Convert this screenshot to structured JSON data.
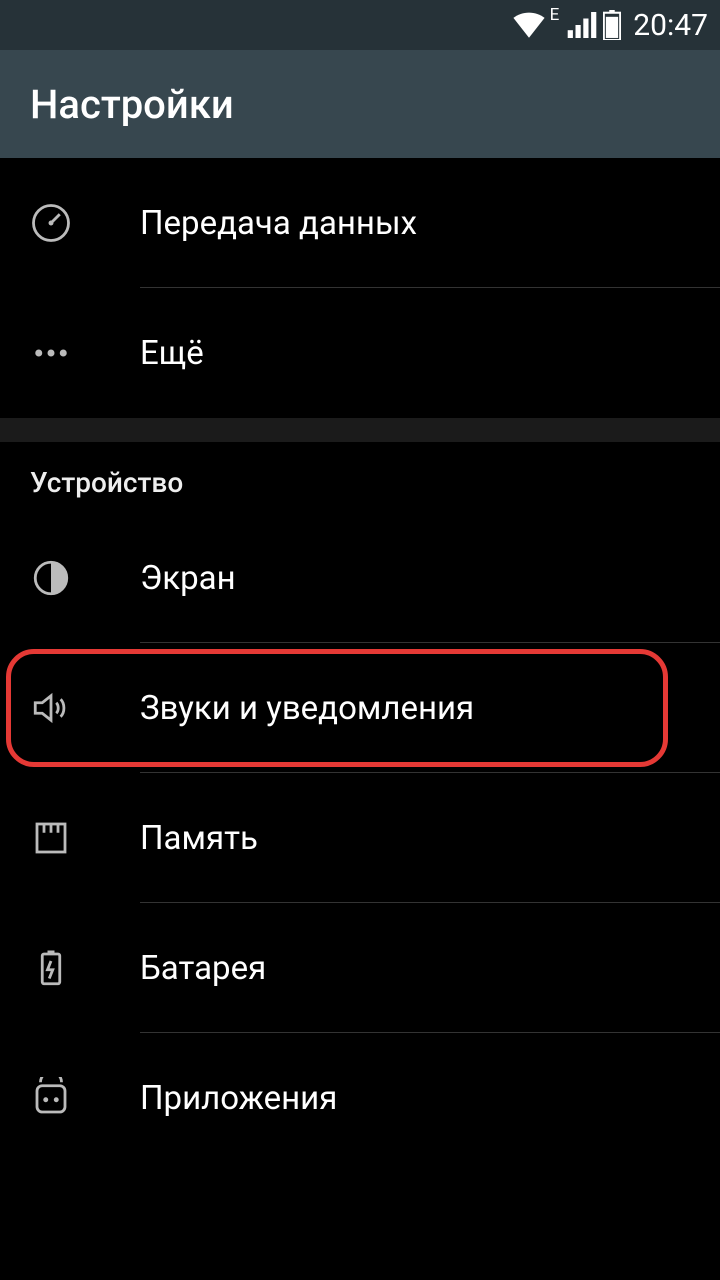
{
  "status": {
    "network_label": "E",
    "time": "20:47"
  },
  "header": {
    "title": "Настройки"
  },
  "top_items": [
    {
      "id": "data-usage",
      "label": "Передача данных",
      "icon": "gauge"
    },
    {
      "id": "more",
      "label": "Ещё",
      "icon": "dots"
    }
  ],
  "device_section": {
    "title": "Устройство",
    "items": [
      {
        "id": "display",
        "label": "Экран",
        "icon": "brightness"
      },
      {
        "id": "sound",
        "label": "Звуки и уведомления",
        "icon": "speaker",
        "highlighted": true
      },
      {
        "id": "storage",
        "label": "Память",
        "icon": "storage"
      },
      {
        "id": "battery",
        "label": "Батарея",
        "icon": "battery"
      },
      {
        "id": "apps",
        "label": "Приложения",
        "icon": "apps"
      }
    ]
  }
}
